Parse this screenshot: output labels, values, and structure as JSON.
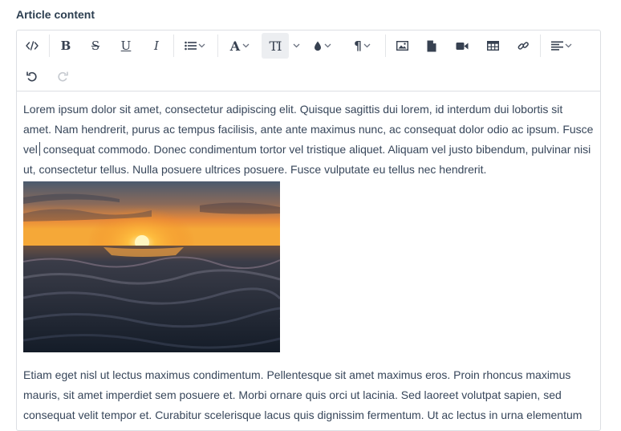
{
  "field": {
    "label": "Article content"
  },
  "toolbar": {
    "row1": [
      {
        "name": "code-view-button",
        "icon": "code-icon"
      },
      {
        "name": "bold-button",
        "icon": "bold-icon",
        "glyph": "B"
      },
      {
        "name": "strikethrough-button",
        "icon": "strikethrough-icon",
        "glyph": "S"
      },
      {
        "name": "underline-button",
        "icon": "underline-icon",
        "glyph": "U"
      },
      {
        "name": "italic-button",
        "icon": "italic-icon",
        "glyph": "I"
      },
      {
        "name": "list-button",
        "icon": "list-icon"
      },
      {
        "name": "font-family-button",
        "icon": "font-icon",
        "glyph": "A"
      },
      {
        "name": "font-size-button",
        "icon": "text-size-icon",
        "glyph": "TI"
      },
      {
        "name": "color-button",
        "icon": "droplet-icon"
      },
      {
        "name": "paragraph-format-button",
        "icon": "paragraph-icon",
        "glyph": "¶"
      },
      {
        "name": "insert-image-button",
        "icon": "image-icon"
      },
      {
        "name": "insert-file-button",
        "icon": "file-icon"
      },
      {
        "name": "insert-video-button",
        "icon": "video-icon"
      },
      {
        "name": "insert-table-button",
        "icon": "table-icon"
      },
      {
        "name": "insert-link-button",
        "icon": "link-icon"
      },
      {
        "name": "align-button",
        "icon": "align-left-icon"
      }
    ],
    "row2": [
      {
        "name": "undo-button",
        "icon": "undo-icon",
        "enabled": true
      },
      {
        "name": "redo-button",
        "icon": "redo-icon",
        "enabled": false
      }
    ],
    "active_item": "font-size-button"
  },
  "content": {
    "paragraph1": "Lorem ipsum dolor sit amet, consectetur adipiscing elit. Quisque sagittis dui lorem, id interdum dui lobortis sit amet. Nam hendrerit, purus ac tempus facilisis, ante ante maximus nunc, ac consequat dolor odio ac ipsum. Fusce vel",
    "paragraph1_end": "consequat commodo. Donec condimentum tortor vel tristique aliquet. Aliquam vel justo bibendum, pulvinar nisi ut, consectetur tellus. Nulla posuere ultrices posuere. Fusce vulputate eu tellus nec hendrerit.",
    "image": {
      "subject": "sunset over ocean waves"
    },
    "paragraph2": "Etiam eget nisl ut lectus maximus condimentum. Pellentesque sit amet maximus eros. Proin rhoncus maximus mauris, sit amet imperdiet sem posuere et. Morbi ornare quis orci ut lacinia. Sed laoreet volutpat sapien, sed consequat velit tempor et. Curabitur scelerisque lacus quis dignissim fermentum. Ut ac lectus in urna elementum"
  },
  "colors": {
    "sun": "#ffb020",
    "sky_top": "#3a4a5e",
    "sea": "#1e2836"
  }
}
